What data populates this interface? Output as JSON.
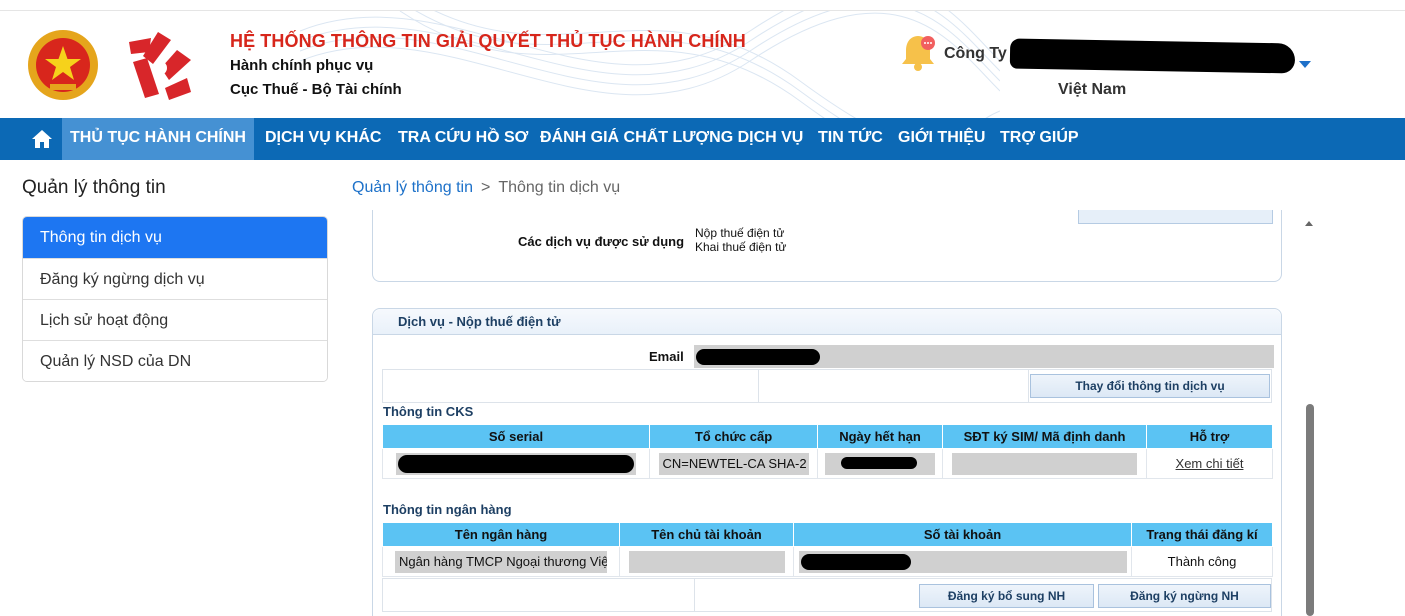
{
  "header": {
    "system_title": "HỆ THỐNG THÔNG TIN GIẢI QUYẾT THỦ TỤC HÀNH CHÍNH",
    "subtitle1": "Hành chính phục vụ",
    "subtitle2": "Cục Thuế - Bộ Tài chính",
    "company_prefix": "Công Ty",
    "country": "Việt Nam"
  },
  "nav": {
    "items": [
      "THỦ TỤC HÀNH CHÍNH",
      "DỊCH VỤ KHÁC",
      "TRA CỨU HỒ SƠ",
      "ĐÁNH GIÁ CHẤT LƯỢNG DỊCH VỤ",
      "TIN TỨC",
      "GIỚI THIỆU",
      "TRỢ GIÚP"
    ]
  },
  "sidebar": {
    "title": "Quản lý thông tin",
    "items": [
      "Thông tin dịch vụ",
      "Đăng ký ngừng dịch vụ",
      "Lịch sử hoạt động",
      "Quản lý NSD của DN"
    ]
  },
  "breadcrumb": {
    "parent": "Quản lý thông tin",
    "separator": ">",
    "current": "Thông tin dịch vụ"
  },
  "services": {
    "label": "Các dịch vụ được sử dụng",
    "values": [
      "Nộp thuế điện tử",
      "Khai thuế điện tử"
    ]
  },
  "service_panel": {
    "title": "Dịch vụ - Nộp thuế điện tử",
    "email_label": "Email",
    "change_button": "Thay đổi thông tin dịch vụ"
  },
  "cks": {
    "title": "Thông tin CKS",
    "headers": [
      "Số serial",
      "Tổ chức cấp",
      "Ngày hết hạn",
      "SĐT ký SIM/ Mã định danh",
      "Hỗ trợ"
    ],
    "issuer": "CN=NEWTEL-CA SHA-2",
    "detail_link": "Xem chi tiết"
  },
  "bank": {
    "title": "Thông tin ngân hàng",
    "headers": [
      "Tên ngân hàng",
      "Tên chủ tài khoản",
      "Số tài khoản",
      "Trạng thái đăng kí"
    ],
    "bank_name": "Ngân hàng TMCP Ngoại thương Việt Nam",
    "status": "Thành công",
    "add_button": "Đăng ký bổ sung NH",
    "stop_button": "Đăng ký ngừng NH"
  },
  "colors": {
    "nav_bg": "#0c69b5",
    "nav_active": "#4591d3",
    "title_red": "#d7261b",
    "sidebar_active": "#1d76f2",
    "table_header": "#5bc3f3"
  }
}
